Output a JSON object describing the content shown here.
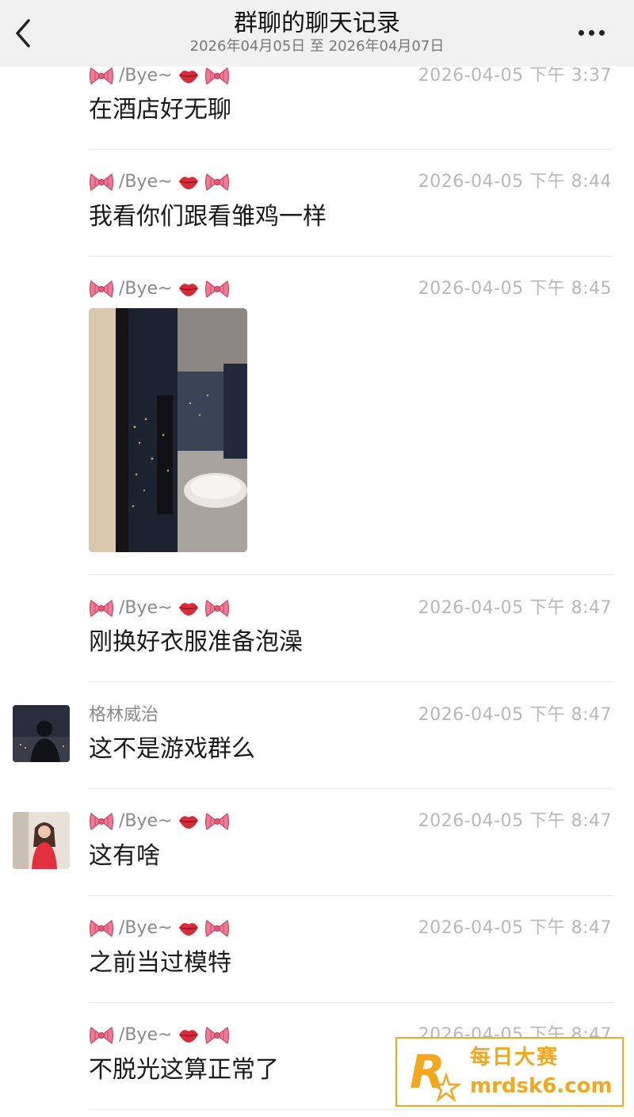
{
  "header": {
    "title": "群聊的聊天记录",
    "subtitle": "2026年04月05日 至 2026年04月07日"
  },
  "messages": [
    {
      "sender": "/Bye~",
      "time": "2026-04-05 下午 3:37",
      "text": "在酒店好无聊"
    },
    {
      "sender": "/Bye~",
      "time": "2026-04-05 下午 8:44",
      "text": "我看你们跟看雏鸡一样"
    },
    {
      "sender": "/Bye~",
      "time": "2026-04-05 下午 8:45",
      "text": ""
    },
    {
      "sender": "/Bye~",
      "time": "2026-04-05 下午 8:47",
      "text": "刚换好衣服准备泡澡"
    },
    {
      "sender": "格林威治",
      "time": "2026-04-05 下午 8:47",
      "text": "这不是游戏群么"
    },
    {
      "sender": "/Bye~",
      "time": "2026-04-05 下午 8:47",
      "text": "这有啥"
    },
    {
      "sender": "/Bye~",
      "time": "2026-04-05 下午 8:47",
      "text": "之前当过模特"
    },
    {
      "sender": "/Bye~",
      "time": "2026-04-05 下午 8:47",
      "text": "不脱光这算正常了"
    }
  ],
  "watermark": {
    "line1": "每日大赛",
    "line2": "mrdsk6.com"
  },
  "colors": {
    "accent": "#f2a71f",
    "bow": "#e05a7a",
    "lips": "#d92b3a"
  },
  "icons": [
    "back-arrow-icon",
    "more-dots-icon",
    "bow-icon",
    "lips-icon"
  ]
}
